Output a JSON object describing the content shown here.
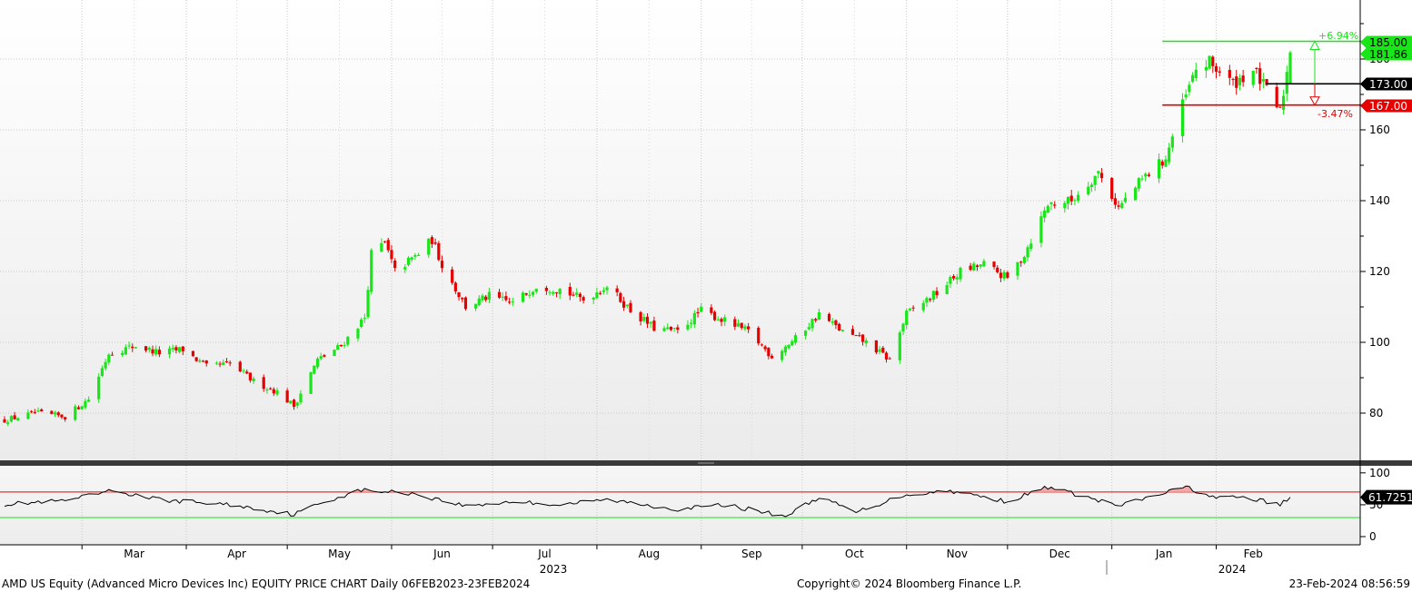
{
  "chart_data": [
    {
      "type": "candlestick",
      "title": "AMD US Equity (Advanced Micro Devices Inc) EQUITY PRICE CHART  Daily 06FEB2023-23FEB2024",
      "y_axis": {
        "ticks": [
          "80",
          "100",
          "120",
          "140",
          "160",
          "180"
        ],
        "ylim": [
          67,
          196
        ],
        "side": "right"
      },
      "x_axis": {
        "months": [
          {
            "label": "Mar",
            "date": "2023-03"
          },
          {
            "label": "Apr",
            "date": "2023-04"
          },
          {
            "label": "May",
            "date": "2023-05"
          },
          {
            "label": "Jun",
            "date": "2023-06"
          },
          {
            "label": "Jul",
            "date": "2023-07"
          },
          {
            "label": "Aug",
            "date": "2023-08"
          },
          {
            "label": "Sep",
            "date": "2023-09"
          },
          {
            "label": "Oct",
            "date": "2023-10"
          },
          {
            "label": "Nov",
            "date": "2023-11"
          },
          {
            "label": "Dec",
            "date": "2023-12"
          },
          {
            "label": "Jan",
            "date": "2024-01"
          },
          {
            "label": "Feb",
            "date": "2024-02"
          }
        ],
        "years": [
          {
            "label": "2023"
          },
          {
            "label": "2024"
          }
        ]
      },
      "anchors": [
        [
          "2023-02-06",
          78
        ],
        [
          "2023-02-15",
          80
        ],
        [
          "2023-02-24",
          79
        ],
        [
          "2023-03-03",
          84
        ],
        [
          "2023-03-09",
          97
        ],
        [
          "2023-03-17",
          99
        ],
        [
          "2023-03-24",
          97
        ],
        [
          "2023-03-31",
          98
        ],
        [
          "2023-04-07",
          93
        ],
        [
          "2023-04-14",
          94
        ],
        [
          "2023-04-21",
          89
        ],
        [
          "2023-04-28",
          86
        ],
        [
          "2023-05-03",
          82
        ],
        [
          "2023-05-10",
          95
        ],
        [
          "2023-05-17",
          99
        ],
        [
          "2023-05-24",
          107
        ],
        [
          "2023-05-26",
          125
        ],
        [
          "2023-05-30",
          128
        ],
        [
          "2023-06-02",
          120
        ],
        [
          "2023-06-09",
          125
        ],
        [
          "2023-06-13",
          129
        ],
        [
          "2023-06-16",
          122
        ],
        [
          "2023-06-23",
          110
        ],
        [
          "2023-06-30",
          113
        ],
        [
          "2023-07-07",
          111
        ],
        [
          "2023-07-14",
          116
        ],
        [
          "2023-07-21",
          115
        ],
        [
          "2023-07-28",
          112
        ],
        [
          "2023-08-04",
          116
        ],
        [
          "2023-08-11",
          109
        ],
        [
          "2023-08-18",
          104
        ],
        [
          "2023-08-25",
          103
        ],
        [
          "2023-09-01",
          109
        ],
        [
          "2023-09-08",
          106
        ],
        [
          "2023-09-15",
          103
        ],
        [
          "2023-09-22",
          96
        ],
        [
          "2023-09-29",
          101
        ],
        [
          "2023-10-06",
          108
        ],
        [
          "2023-10-13",
          103
        ],
        [
          "2023-10-20",
          100
        ],
        [
          "2023-10-27",
          95
        ],
        [
          "2023-11-01",
          108
        ],
        [
          "2023-11-10",
          114
        ],
        [
          "2023-11-17",
          120
        ],
        [
          "2023-11-24",
          122
        ],
        [
          "2023-12-01",
          118
        ],
        [
          "2023-12-06",
          125
        ],
        [
          "2023-12-13",
          139
        ],
        [
          "2023-12-20",
          140
        ],
        [
          "2023-12-28",
          148
        ],
        [
          "2024-01-03",
          138
        ],
        [
          "2024-01-10",
          146
        ],
        [
          "2024-01-17",
          152
        ],
        [
          "2024-01-22",
          167
        ],
        [
          "2024-01-26",
          177
        ],
        [
          "2024-01-30",
          179
        ],
        [
          "2024-02-06",
          173
        ],
        [
          "2024-02-12",
          177
        ],
        [
          "2024-02-16",
          171
        ],
        [
          "2024-02-20",
          165
        ],
        [
          "2024-02-23",
          181.86
        ]
      ],
      "price_levels": [
        {
          "label": "185.00",
          "value": 185.0,
          "color": "#19e619"
        },
        {
          "label": "181.86",
          "value": 181.86,
          "color": "#19e619"
        },
        {
          "label": "173.00",
          "value": 173.0,
          "color": "#000000"
        },
        {
          "label": "167.00",
          "value": 167.0,
          "color": "#e60000"
        }
      ],
      "annotations": [
        {
          "text": "+6.94%",
          "color": "#19e619"
        },
        {
          "text": "-3.47%",
          "color": "#e60000"
        }
      ],
      "colors": {
        "up": "#19e619",
        "down": "#e60000"
      }
    },
    {
      "type": "line",
      "y_axis": {
        "ticks": [
          "0",
          "50",
          "100"
        ],
        "ylim": [
          -5,
          108
        ]
      },
      "reference_lines": [
        {
          "value": 70,
          "color": "#e60000"
        },
        {
          "value": 30,
          "color": "#19e619"
        }
      ],
      "last_value": {
        "label": "61.7251",
        "value": 61.7251
      },
      "anchors": [
        [
          "2023-02-06",
          51
        ],
        [
          "2023-02-24",
          56
        ],
        [
          "2023-03-10",
          72
        ],
        [
          "2023-03-24",
          58
        ],
        [
          "2023-04-14",
          50
        ],
        [
          "2023-05-03",
          35
        ],
        [
          "2023-05-12",
          55
        ],
        [
          "2023-05-23",
          73
        ],
        [
          "2023-06-07",
          68
        ],
        [
          "2023-06-23",
          48
        ],
        [
          "2023-07-07",
          55
        ],
        [
          "2023-07-21",
          50
        ],
        [
          "2023-08-04",
          58
        ],
        [
          "2023-08-25",
          43
        ],
        [
          "2023-09-08",
          50
        ],
        [
          "2023-09-26",
          32
        ],
        [
          "2023-10-06",
          62
        ],
        [
          "2023-10-17",
          38
        ],
        [
          "2023-10-31",
          65
        ],
        [
          "2023-11-14",
          72
        ],
        [
          "2023-12-01",
          55
        ],
        [
          "2023-12-13",
          78
        ],
        [
          "2024-01-03",
          48
        ],
        [
          "2024-01-23",
          78
        ],
        [
          "2024-02-01",
          60
        ],
        [
          "2024-02-09",
          62
        ],
        [
          "2024-02-20",
          50
        ],
        [
          "2024-02-23",
          61.7251
        ]
      ],
      "color": "#000000"
    }
  ],
  "footer": {
    "left": "AMD US Equity (Advanced Micro Devices Inc) EQUITY PRICE CHART  Daily 06FEB2023-23FEB2024",
    "center": "Copyright© 2024 Bloomberg Finance L.P.",
    "right": "23-Feb-2024 08:56:59"
  }
}
